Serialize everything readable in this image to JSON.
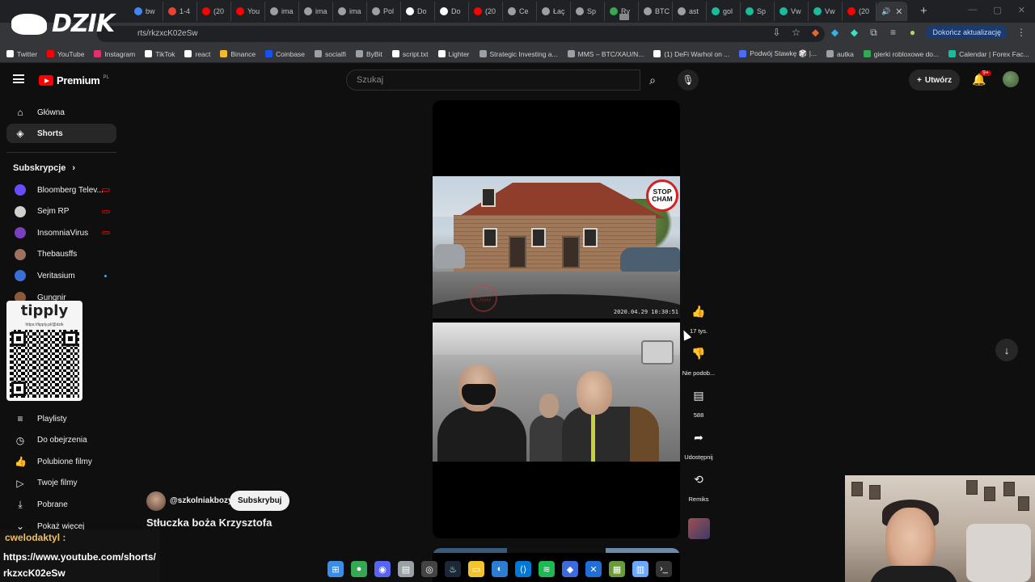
{
  "browser": {
    "tabs": [
      {
        "label": "bw",
        "color": "#4285f4"
      },
      {
        "label": "1-4",
        "color": "#ea4335"
      },
      {
        "label": "(20",
        "color": "#ff0000"
      },
      {
        "label": "You",
        "color": "#ff0000"
      },
      {
        "label": "ima",
        "color": "#9aa0a6"
      },
      {
        "label": "ima",
        "color": "#9aa0a6"
      },
      {
        "label": "ima",
        "color": "#9aa0a6"
      },
      {
        "label": "Pol",
        "color": "#9aa0a6"
      },
      {
        "label": "Do",
        "color": "#ffffff"
      },
      {
        "label": "Do",
        "color": "#ffffff"
      },
      {
        "label": "(20",
        "color": "#ff0000"
      },
      {
        "label": "Ce",
        "color": "#9aa0a6"
      },
      {
        "label": "Łaç",
        "color": "#9aa0a6"
      },
      {
        "label": "Sp",
        "color": "#9aa0a6"
      },
      {
        "label": "Ry",
        "color": "#34a853"
      },
      {
        "label": "BTC",
        "color": "#9aa0a6"
      },
      {
        "label": "ast",
        "color": "#9aa0a6"
      },
      {
        "label": "gol",
        "color": "#1abc9c"
      },
      {
        "label": "Sp",
        "color": "#1abc9c"
      },
      {
        "label": "Vw",
        "color": "#1abc9c"
      },
      {
        "label": "Vw",
        "color": "#1abc9c"
      },
      {
        "label": "(20",
        "color": "#ff0000"
      }
    ],
    "active_tab_close": "✕",
    "new_tab": "+",
    "url": "rts/rkzxcK02eSw",
    "update_button": "Dokończ aktualizację",
    "bookmarks": [
      {
        "label": "Twitter",
        "color": "#ffffff"
      },
      {
        "label": "YouTube",
        "color": "#ff0000"
      },
      {
        "label": "Instagram",
        "color": "#e1306c"
      },
      {
        "label": "TikTok",
        "color": "#ffffff"
      },
      {
        "label": "react",
        "color": "#ffffff"
      },
      {
        "label": "Binance",
        "color": "#f3ba2f"
      },
      {
        "label": "Coinbase",
        "color": "#1652f0"
      },
      {
        "label": "socialfi",
        "color": "#9aa0a6"
      },
      {
        "label": "ByBit",
        "color": "#9aa0a6"
      },
      {
        "label": "script.txt",
        "color": "#ffffff"
      },
      {
        "label": "Lighter",
        "color": "#ffffff"
      },
      {
        "label": "Strategic Investing a...",
        "color": "#9aa0a6"
      },
      {
        "label": "MMS – BTC/XAU/N...",
        "color": "#9aa0a6"
      },
      {
        "label": "(1) DeFi Warhol on ...",
        "color": "#ffffff"
      },
      {
        "label": "Podwój Stawkę 🎲 |...",
        "color": "#4a6cf7"
      },
      {
        "label": "autka",
        "color": "#9aa0a6"
      },
      {
        "label": "gierki robloxowe do...",
        "color": "#34a853"
      },
      {
        "label": "Calendar | Forex Fac...",
        "color": "#1abc9c"
      }
    ]
  },
  "youtube": {
    "logo_text": "Premium",
    "logo_region": "PL",
    "search_placeholder": "Szukaj",
    "create_label": "Utwórz",
    "notification_count": "9+",
    "sidebar": {
      "main": [
        {
          "label": "Główna",
          "icon": "home-icon",
          "glyph": "⌂"
        },
        {
          "label": "Shorts",
          "icon": "shorts-icon",
          "glyph": "◈",
          "active": true
        }
      ],
      "subscriptions_header": "Subskrypcje",
      "subscriptions": [
        {
          "label": "Bloomberg Telev...",
          "color": "#6a4cff",
          "indicator": "live"
        },
        {
          "label": "Sejm RP",
          "color": "#d0d0d0",
          "indicator": "live"
        },
        {
          "label": "InsomniaVirus",
          "color": "#7a3fbf",
          "indicator": "live"
        },
        {
          "label": "Thebausffs",
          "color": "#a07060",
          "indicator": "none"
        },
        {
          "label": "Veritasium",
          "color": "#3a6fd8",
          "indicator": "new"
        },
        {
          "label": "Gungnir",
          "color": "#8a5a3a",
          "indicator": "none"
        }
      ],
      "you_items": [
        {
          "label": "Playlisty",
          "icon": "playlist-icon",
          "glyph": "≡"
        },
        {
          "label": "Do obejrzenia",
          "icon": "clock-icon",
          "glyph": "◷"
        },
        {
          "label": "Polubione filmy",
          "icon": "like-icon",
          "glyph": "👍"
        },
        {
          "label": "Twoje filmy",
          "icon": "video-icon",
          "glyph": "▷"
        },
        {
          "label": "Pobrane",
          "icon": "download-icon",
          "glyph": "⤓"
        },
        {
          "label": "Pokaż więcej",
          "icon": "chevron-down-icon",
          "glyph": "⌄"
        }
      ]
    },
    "short": {
      "stop_badge_line1": "STOP",
      "stop_badge_line2": "CHAM",
      "watermark": "STOP CHAM",
      "timestamp": "2020.04.29 10:30:51",
      "channel": "@szkolniakbozy",
      "subscribe_label": "Subskrybuj",
      "title": "Stłuczka boża Krzysztofa"
    },
    "actions": {
      "likes": "17 tys.",
      "dislike": "Nie podob...",
      "comments": "588",
      "share": "Udostępnij",
      "remix": "Remiks"
    }
  },
  "overlays": {
    "stream_logo": "DZIK",
    "tipply_title": "tipply",
    "tipply_url": "https://tipply.pl/@dzik",
    "chat_user": "cwelodaktyl :",
    "chat_message": "https://www.youtube.com/shorts/rkzxcK02eSw"
  },
  "taskbar": [
    {
      "name": "windows-start-icon",
      "color": "#3a8ee6",
      "glyph": "⊞"
    },
    {
      "name": "chrome-icon",
      "color": "#34a853",
      "glyph": "●"
    },
    {
      "name": "discord-icon",
      "color": "#5865f2",
      "glyph": "◉"
    },
    {
      "name": "notepad-icon",
      "color": "#9aa0a6",
      "glyph": "▤"
    },
    {
      "name": "obs-icon",
      "color": "#444444",
      "glyph": "◎"
    },
    {
      "name": "steam-icon",
      "color": "#1b2838",
      "glyph": "♨"
    },
    {
      "name": "folder-icon",
      "color": "#f4c430",
      "glyph": "▭"
    },
    {
      "name": "app-icon",
      "color": "#2d7dd2",
      "glyph": "◐"
    },
    {
      "name": "vscode-icon",
      "color": "#0078d4",
      "glyph": "⟨⟩"
    },
    {
      "name": "spotify-icon",
      "color": "#1db954",
      "glyph": "≋"
    },
    {
      "name": "app2-icon",
      "color": "#3d6bdd",
      "glyph": "◆"
    },
    {
      "name": "excel-icon",
      "color": "#1f6fd6",
      "glyph": "✕"
    },
    {
      "name": "minecraft-icon",
      "color": "#6a9a3a",
      "glyph": "▦"
    },
    {
      "name": "notes-icon",
      "color": "#6aa9ff",
      "glyph": "▥"
    },
    {
      "name": "terminal-icon",
      "color": "#333333",
      "glyph": "›_"
    }
  ]
}
